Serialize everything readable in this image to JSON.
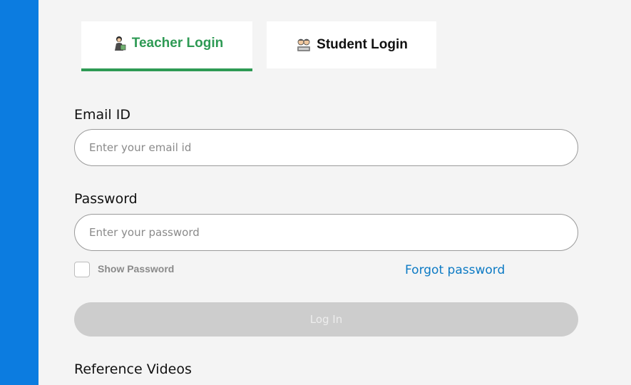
{
  "tabs": {
    "teacher": {
      "label": "Teacher Login",
      "icon": "teacher-icon",
      "active": true,
      "color": "#2e9a54"
    },
    "student": {
      "label": "Student Login",
      "icon": "student-icon",
      "active": false
    }
  },
  "form": {
    "email_label": "Email ID",
    "email_placeholder": "Enter your email id",
    "password_label": "Password",
    "password_placeholder": "Enter your password",
    "show_password_label": "Show Password",
    "show_password_checked": false,
    "forgot_password": "Forgot password",
    "login_button": "Log In"
  },
  "reference_videos_title": "Reference Videos",
  "colors": {
    "sidebar": "#0c7ce0",
    "link": "#0c7ac4",
    "button_disabled": "#cdcdcd"
  }
}
